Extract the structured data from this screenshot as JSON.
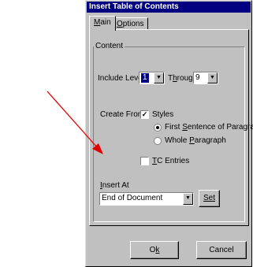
{
  "dialog": {
    "title": "Insert Table of Contents"
  },
  "tabs": [
    {
      "label_u": "M",
      "label_rest": "ain",
      "active": true
    },
    {
      "label_u": "O",
      "label_rest": "ptions",
      "active": false
    }
  ],
  "content": {
    "group_label": "Content",
    "include_levels_label": "Include Levels:",
    "from_level": "1",
    "through_label_u": "h",
    "through_label_pre": "T",
    "through_label_post": "rough",
    "through_level": "9",
    "create_from_label": "Create From:",
    "styles_label": "Styles",
    "styles_checked": true,
    "first_sentence_label_u": "S",
    "first_sentence_label_pre": "First ",
    "first_sentence_label_post": "entence of Paragraph",
    "first_sentence_selected": true,
    "whole_paragraph_label_u": "P",
    "whole_paragraph_label_pre": "Whole ",
    "whole_paragraph_label_post": "aragraph",
    "whole_paragraph_selected": false,
    "tc_entries_label_u": "T",
    "tc_entries_label_post": "C Entries",
    "tc_entries_checked": false,
    "insert_at_label_u": "I",
    "insert_at_label_post": "nsert At",
    "insert_at_value": "End of Document",
    "set_button": "Set"
  },
  "footer": {
    "ok_u": "k",
    "ok_pre": "O",
    "cancel": "Cancel"
  },
  "colors": {
    "titlebar": "#000080",
    "face": "#c0c0c0",
    "arrow": "#e00000"
  }
}
